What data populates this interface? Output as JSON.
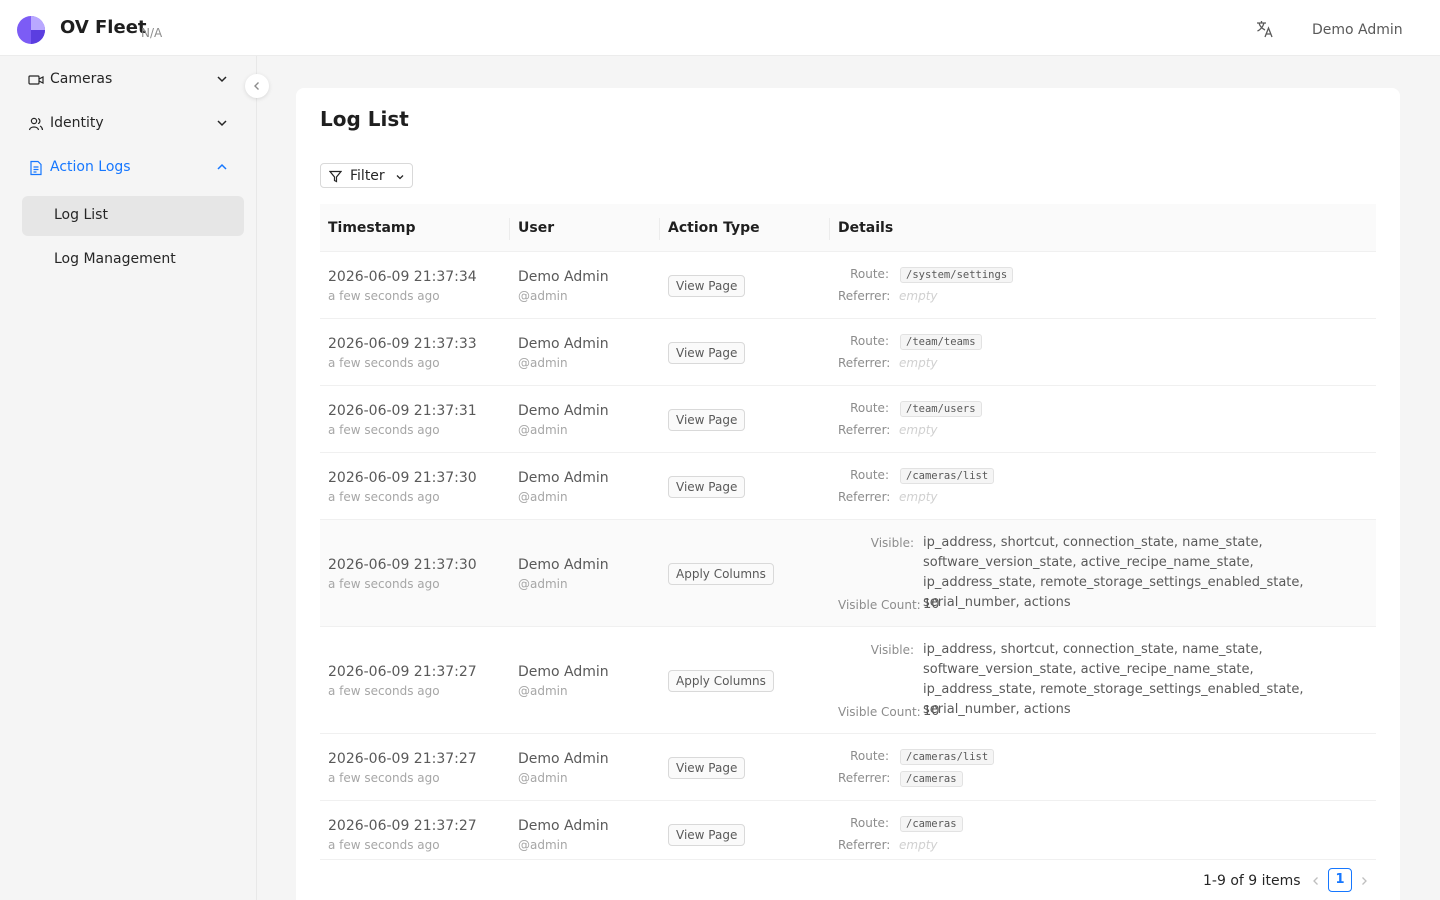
{
  "header": {
    "app_title": "OV Fleet",
    "app_subtitle": "N/A",
    "user_name": "Demo Admin",
    "brand_color": "#6b4ef0"
  },
  "sidebar": {
    "items": [
      {
        "label": "Cameras",
        "icon": "video-camera-icon",
        "expanded": false
      },
      {
        "label": "Identity",
        "icon": "users-icon",
        "expanded": false
      },
      {
        "label": "Action Logs",
        "icon": "file-text-icon",
        "expanded": true
      }
    ],
    "sub_items": [
      {
        "label": "Log List",
        "selected": true
      },
      {
        "label": "Log Management",
        "selected": false
      }
    ],
    "accent_color": "#1677ff"
  },
  "main": {
    "title": "Log List",
    "filter_label": "Filter",
    "columns": [
      "Timestamp",
      "User",
      "Action Type",
      "Details"
    ],
    "detail_labels": {
      "route": "Route:",
      "referrer": "Referrer:",
      "visible": "Visible:",
      "visible_count": "Visible Count:",
      "empty": "empty"
    },
    "rows": [
      {
        "timestamp": "2026-06-09 21:37:34",
        "ago": "a few seconds ago",
        "user": "Demo Admin",
        "handle": "@admin",
        "action": "View Page",
        "route": "/system/settings",
        "referrer": null
      },
      {
        "timestamp": "2026-06-09 21:37:33",
        "ago": "a few seconds ago",
        "user": "Demo Admin",
        "handle": "@admin",
        "action": "View Page",
        "route": "/team/teams",
        "referrer": null
      },
      {
        "timestamp": "2026-06-09 21:37:31",
        "ago": "a few seconds ago",
        "user": "Demo Admin",
        "handle": "@admin",
        "action": "View Page",
        "route": "/team/users",
        "referrer": null
      },
      {
        "timestamp": "2026-06-09 21:37:30",
        "ago": "a few seconds ago",
        "user": "Demo Admin",
        "handle": "@admin",
        "action": "View Page",
        "route": "/cameras/list",
        "referrer": null
      },
      {
        "timestamp": "2026-06-09 21:37:30",
        "ago": "a few seconds ago",
        "user": "Demo Admin",
        "handle": "@admin",
        "action": "Apply Columns",
        "visible": "ip_address, shortcut, connection_state, name_state, software_version_state, active_recipe_name_state, ip_address_state, remote_storage_settings_enabled_state, serial_number, actions",
        "visible_count": "10"
      },
      {
        "timestamp": "2026-06-09 21:37:27",
        "ago": "a few seconds ago",
        "user": "Demo Admin",
        "handle": "@admin",
        "action": "Apply Columns",
        "visible": "ip_address, shortcut, connection_state, name_state, software_version_state, active_recipe_name_state, ip_address_state, remote_storage_settings_enabled_state, serial_number, actions",
        "visible_count": "10"
      },
      {
        "timestamp": "2026-06-09 21:37:27",
        "ago": "a few seconds ago",
        "user": "Demo Admin",
        "handle": "@admin",
        "action": "View Page",
        "route": "/cameras/list",
        "referrer": "/cameras"
      },
      {
        "timestamp": "2026-06-09 21:37:27",
        "ago": "a few seconds ago",
        "user": "Demo Admin",
        "handle": "@admin",
        "action": "View Page",
        "route": "/cameras",
        "referrer": null
      }
    ]
  },
  "pagination": {
    "total_text": "1-9 of 9 items",
    "current_page": "1"
  }
}
